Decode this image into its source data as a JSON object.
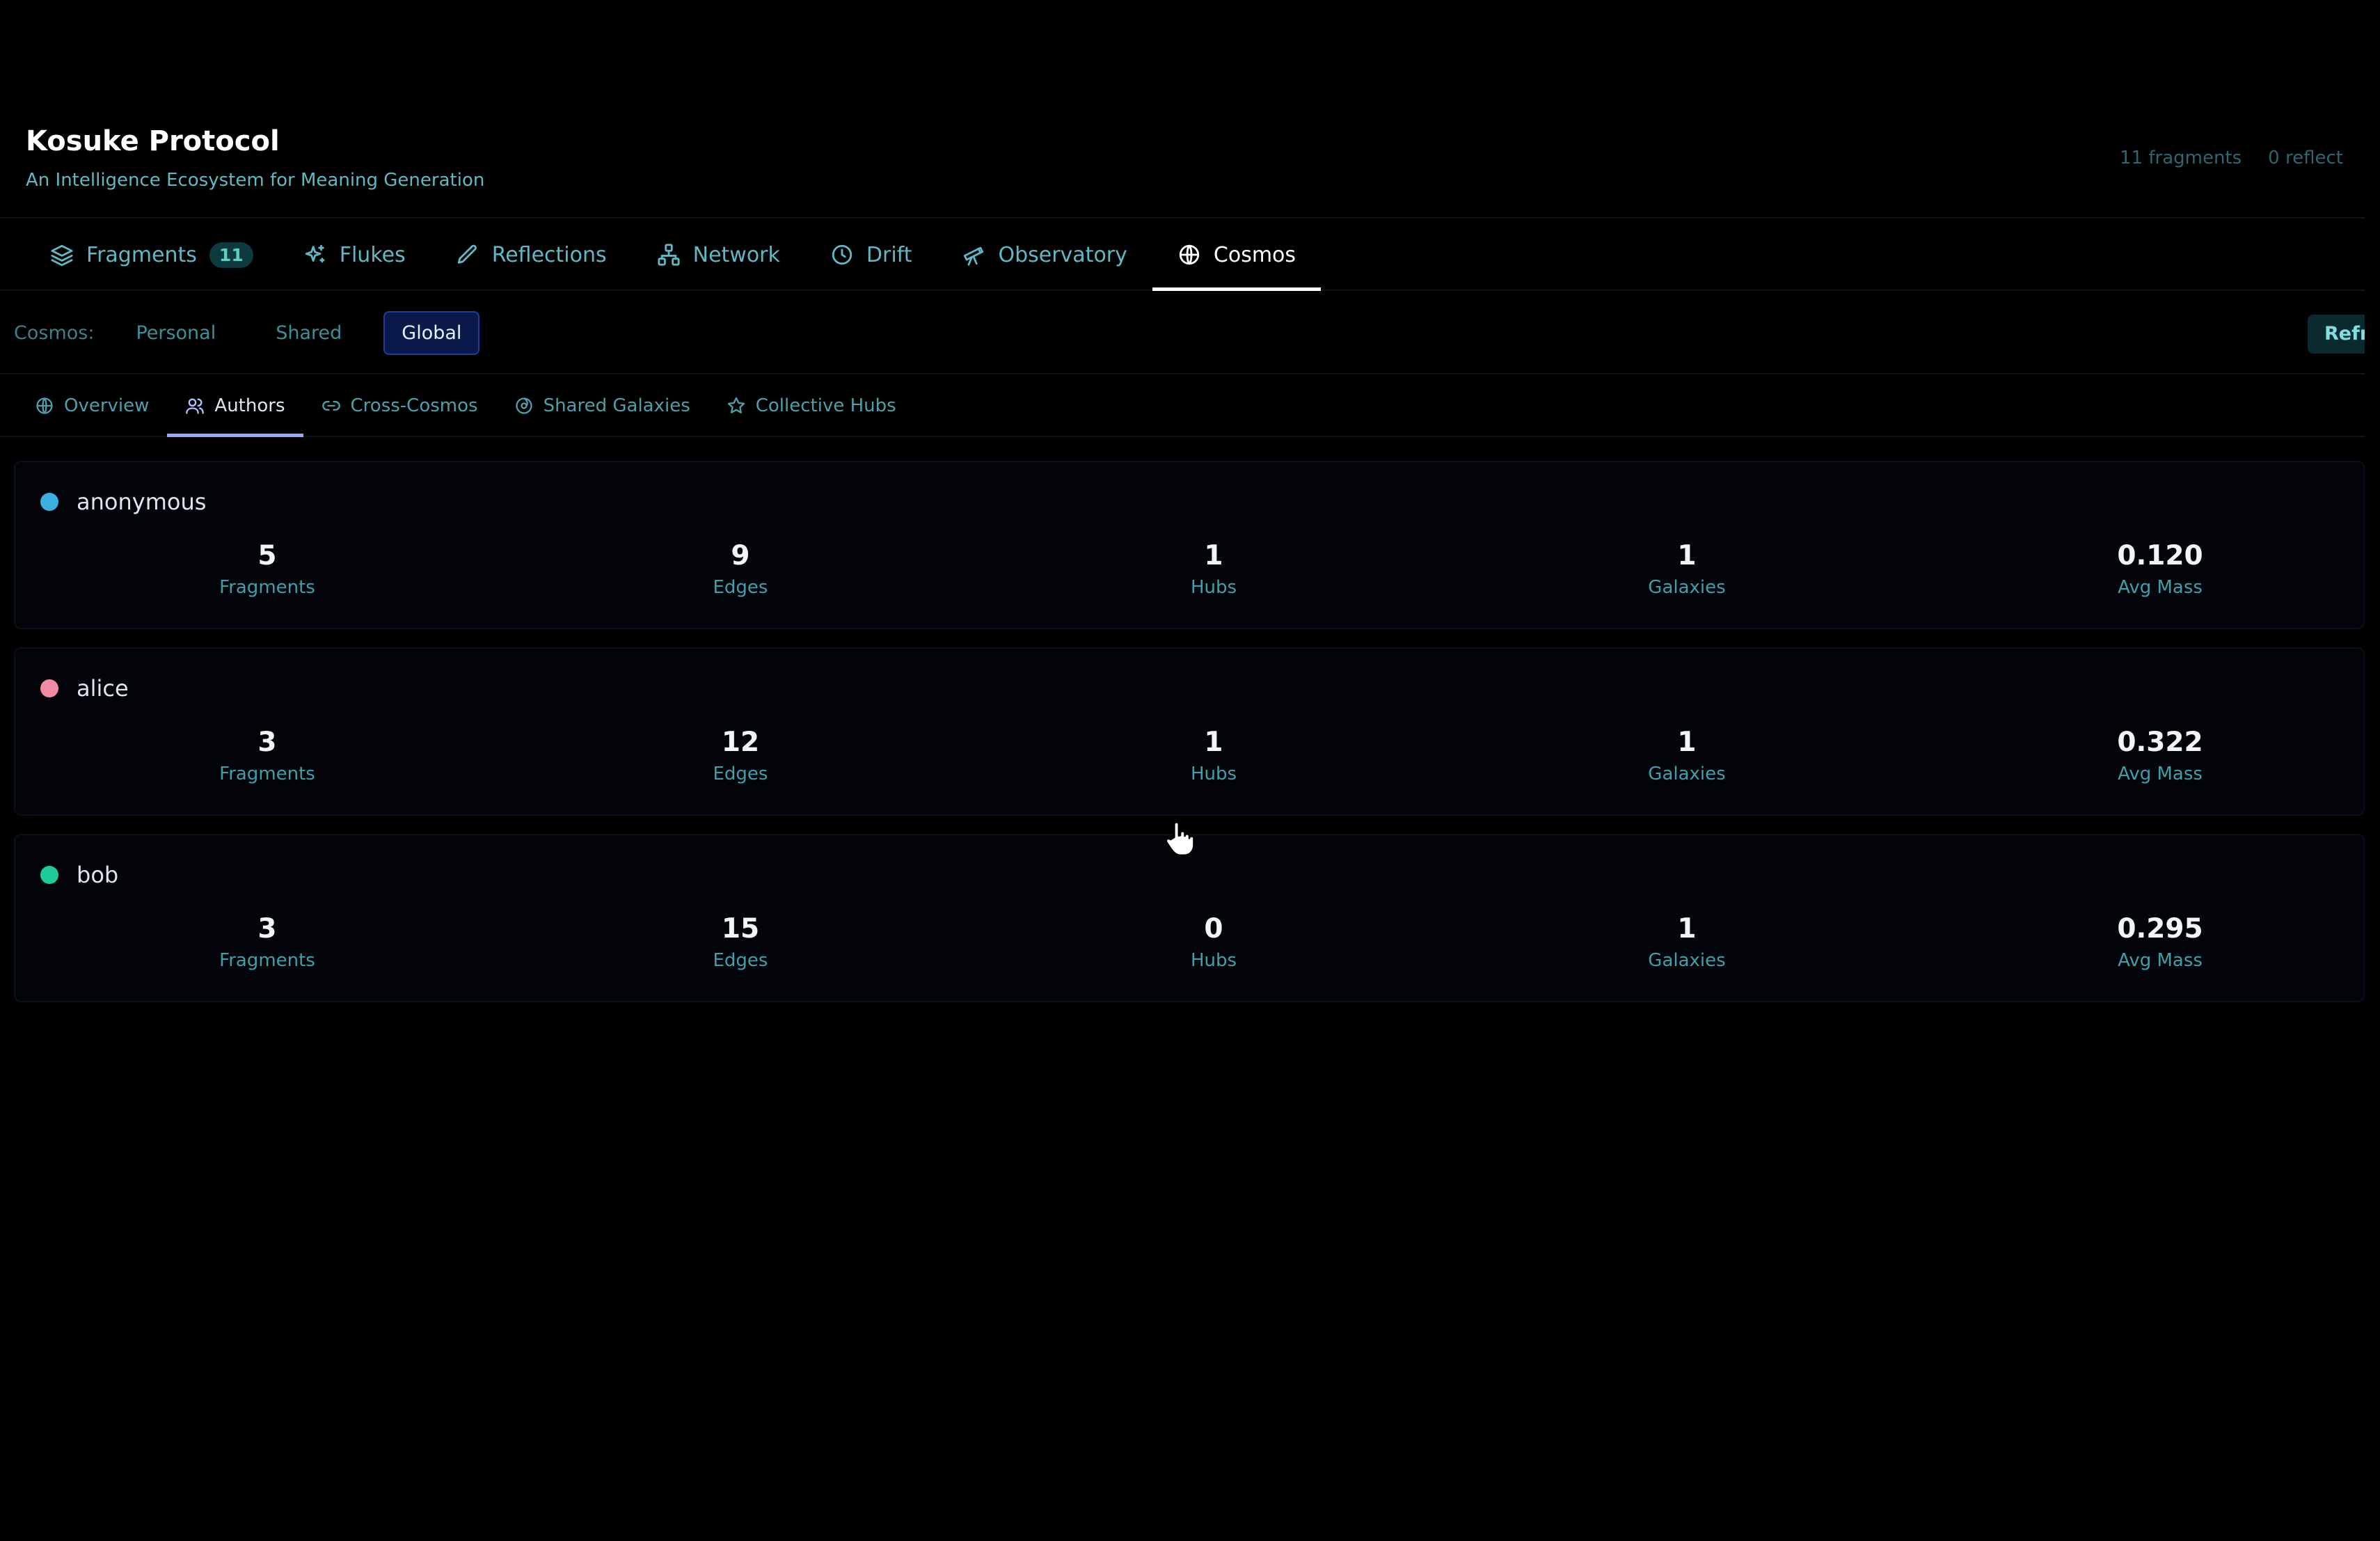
{
  "header": {
    "title": "Kosuke Protocol",
    "subtitle": "An Intelligence Ecosystem for Meaning Generation",
    "stats": [
      "11 fragments",
      "0 reflect"
    ]
  },
  "main_tabs": [
    {
      "label": "Fragments",
      "icon": "layers-icon",
      "badge": "11"
    },
    {
      "label": "Flukes",
      "icon": "sparkles-icon"
    },
    {
      "label": "Reflections",
      "icon": "pen-icon"
    },
    {
      "label": "Network",
      "icon": "network-icon"
    },
    {
      "label": "Drift",
      "icon": "clock-icon"
    },
    {
      "label": "Observatory",
      "icon": "telescope-icon"
    },
    {
      "label": "Cosmos",
      "icon": "globe-icon",
      "active": true
    }
  ],
  "scope": {
    "label": "Cosmos:",
    "options": [
      "Personal",
      "Shared",
      "Global"
    ],
    "selected": "Global",
    "refresh_label": "Refresh"
  },
  "sub_tabs": [
    {
      "label": "Overview",
      "icon": "globe-icon"
    },
    {
      "label": "Authors",
      "icon": "users-icon",
      "active": true
    },
    {
      "label": "Cross-Cosmos",
      "icon": "link-icon"
    },
    {
      "label": "Shared Galaxies",
      "icon": "galaxy-icon"
    },
    {
      "label": "Collective Hubs",
      "icon": "star-icon"
    }
  ],
  "stat_labels": [
    "Fragments",
    "Edges",
    "Hubs",
    "Galaxies",
    "Avg Mass"
  ],
  "authors": [
    {
      "name": "anonymous",
      "color": "#3ab0e0",
      "stats": [
        "5",
        "9",
        "1",
        "1",
        "0.120"
      ]
    },
    {
      "name": "alice",
      "color": "#f08ca0",
      "stats": [
        "3",
        "12",
        "1",
        "1",
        "0.322"
      ]
    },
    {
      "name": "bob",
      "color": "#1ec99a",
      "stats": [
        "3",
        "15",
        "0",
        "1",
        "0.295"
      ]
    }
  ],
  "colors": {
    "accent": "#5fb8c4",
    "active_scope_bg": "#0a1a4a",
    "active_subtab_underline": "#9aa6ff"
  }
}
